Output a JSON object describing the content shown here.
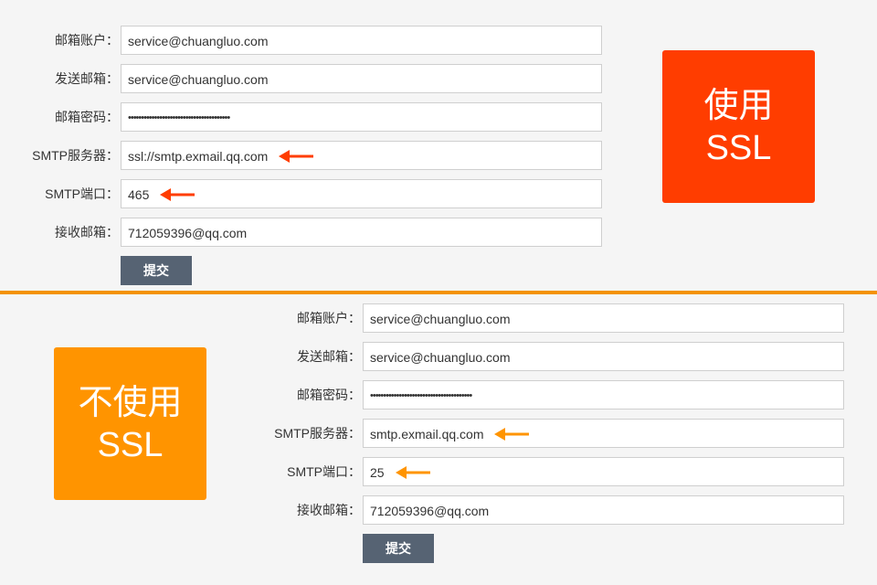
{
  "colors": {
    "accent_red": "#ff3d00",
    "accent_orange": "#ff9400",
    "divider_orange": "#f39200",
    "button_bg": "#566373"
  },
  "ssl_form": {
    "badge": {
      "line1": "使用",
      "line2": "SSL"
    },
    "fields": [
      {
        "label": "邮箱账户：",
        "value": "service@chuangluo.com"
      },
      {
        "label": "发送邮箱：",
        "value": "service@chuangluo.com"
      },
      {
        "label": "邮箱密码：",
        "value": "•••••••••••••••••••••••••••••••••••••••"
      },
      {
        "label": "SMTP服务器：",
        "value": "ssl://smtp.exmail.qq.com"
      },
      {
        "label": "SMTP端口：",
        "value": "465"
      },
      {
        "label": "接收邮箱：",
        "value": "712059396@qq.com"
      }
    ],
    "submit_label": "提交"
  },
  "non_ssl_form": {
    "badge": {
      "line1": "不使用",
      "line2": "SSL"
    },
    "fields": [
      {
        "label": "邮箱账户：",
        "value": "service@chuangluo.com"
      },
      {
        "label": "发送邮箱：",
        "value": "service@chuangluo.com"
      },
      {
        "label": "邮箱密码：",
        "value": "•••••••••••••••••••••••••••••••••••••••"
      },
      {
        "label": "SMTP服务器：",
        "value": "smtp.exmail.qq.com"
      },
      {
        "label": "SMTP端口：",
        "value": "25"
      },
      {
        "label": "接收邮箱：",
        "value": "712059396@qq.com"
      }
    ],
    "submit_label": "提交"
  }
}
